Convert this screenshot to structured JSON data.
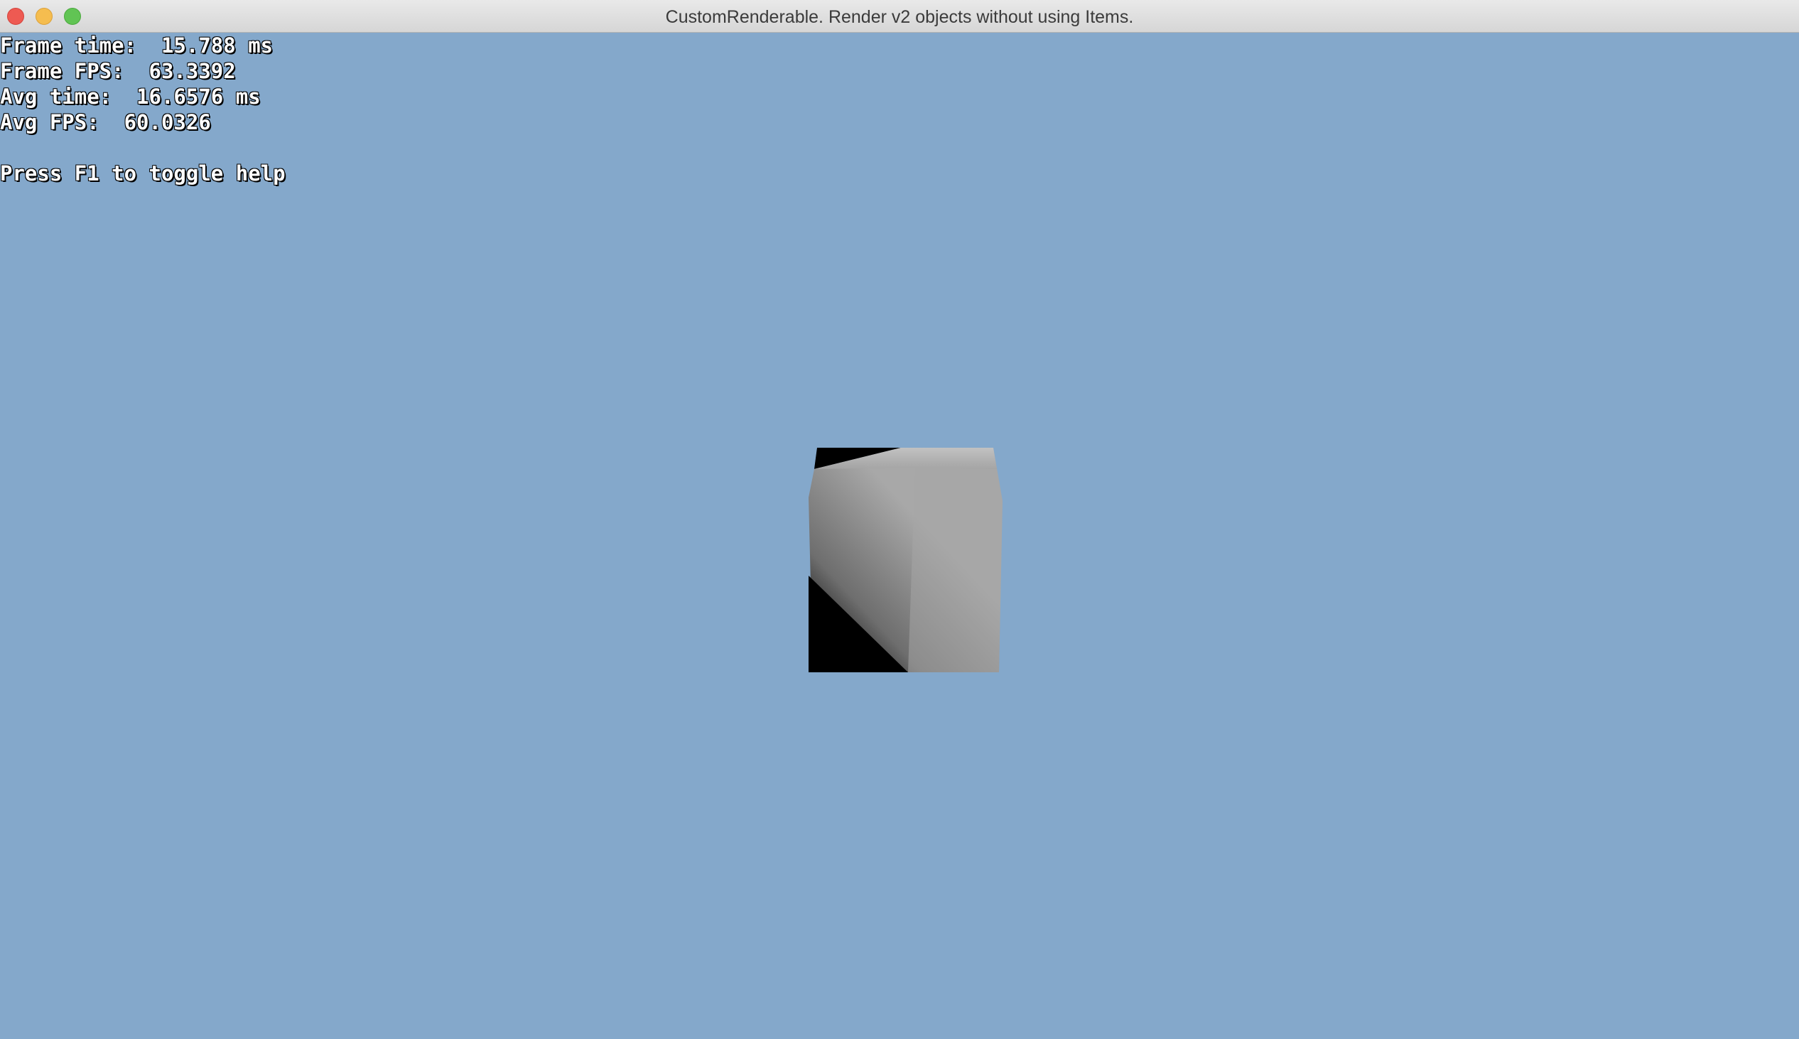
{
  "window": {
    "title": "CustomRenderable. Render v2 objects without using Items."
  },
  "stats": {
    "frame_time": "Frame time:  15.788 ms",
    "frame_fps": "Frame FPS:  63.3392",
    "avg_time": "Avg time:  16.6576 ms",
    "avg_fps": "Avg FPS:  60.0326",
    "help": "Press F1 to toggle help"
  },
  "colors": {
    "background": "#84a8cb",
    "text": "#ffffff",
    "cube_light": "#a5a5a5",
    "cube_dark": "#000000"
  },
  "icons": {
    "close": "close-icon",
    "minimize": "minimize-icon",
    "maximize": "maximize-icon"
  }
}
